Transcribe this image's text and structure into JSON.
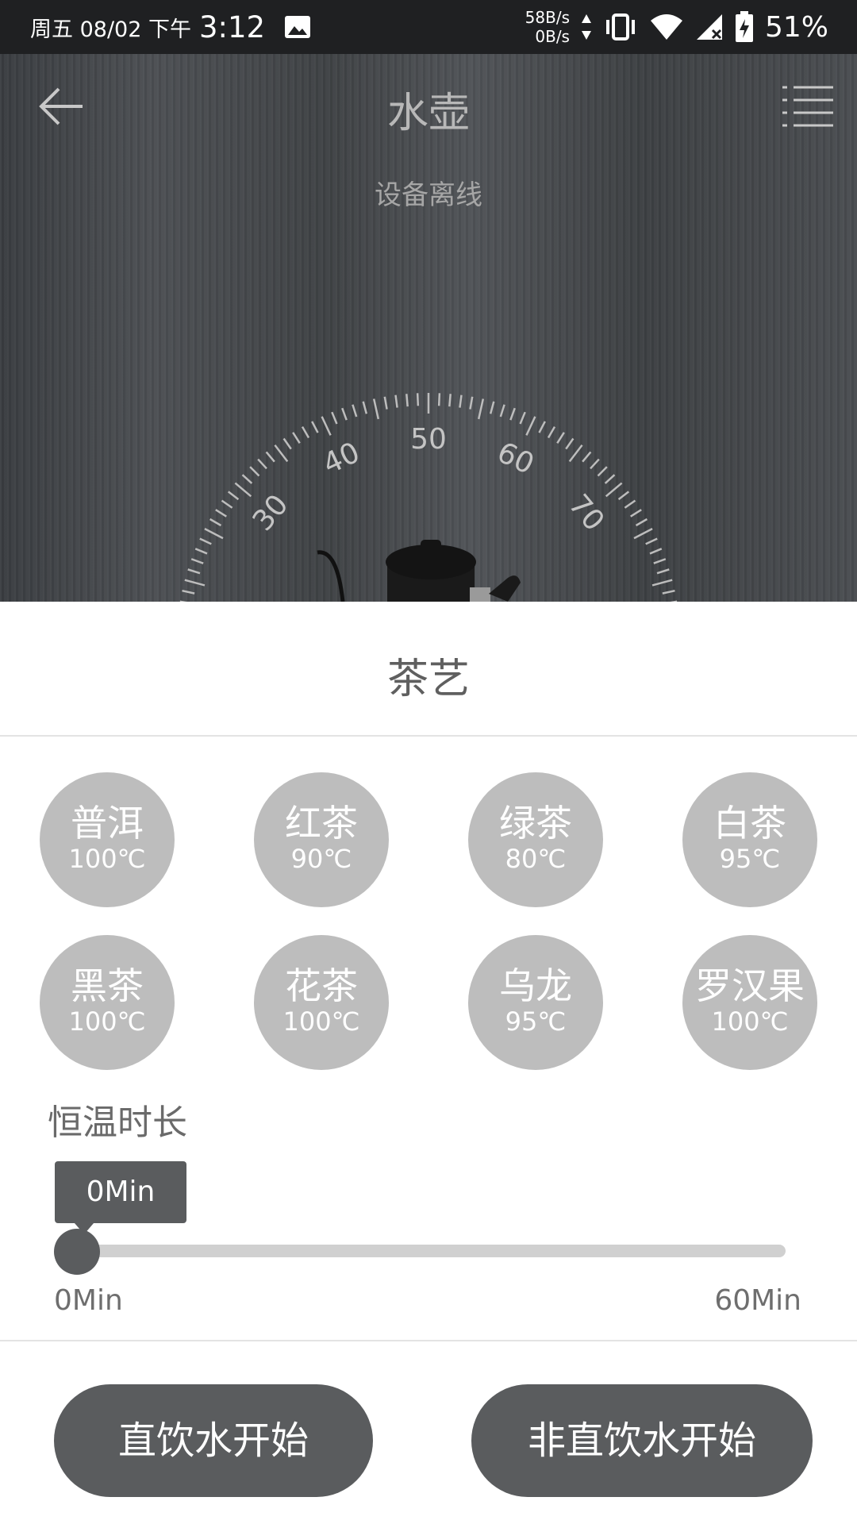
{
  "status_bar": {
    "date": "周五 08/02 下午",
    "time": "3:12",
    "net_up": "58B/s",
    "net_down": "0B/s",
    "battery": "51%"
  },
  "header": {
    "title": "水壶",
    "device_status": "设备离线",
    "dial_labels": [
      "30",
      "40",
      "50",
      "60",
      "70"
    ]
  },
  "sheet": {
    "title": "茶艺",
    "teas": [
      {
        "name": "普洱",
        "temp": "100℃"
      },
      {
        "name": "红茶",
        "temp": "90℃"
      },
      {
        "name": "绿茶",
        "temp": "80℃"
      },
      {
        "name": "白茶",
        "temp": "95℃"
      },
      {
        "name": "黑茶",
        "temp": "100℃"
      },
      {
        "name": "花茶",
        "temp": "100℃"
      },
      {
        "name": "乌龙",
        "temp": "95℃"
      },
      {
        "name": "罗汉果",
        "temp": "100℃"
      }
    ],
    "keep_warm": {
      "label": "恒温时长",
      "value_label": "0Min",
      "value": 0,
      "min_label": "0Min",
      "max_label": "60Min"
    },
    "buttons": {
      "direct": "直饮水开始",
      "indirect": "非直饮水开始"
    }
  },
  "colors": {
    "header_bg": "#43464a",
    "tea_circle": "#bdbdbd",
    "button_bg": "#5a5c5e"
  }
}
